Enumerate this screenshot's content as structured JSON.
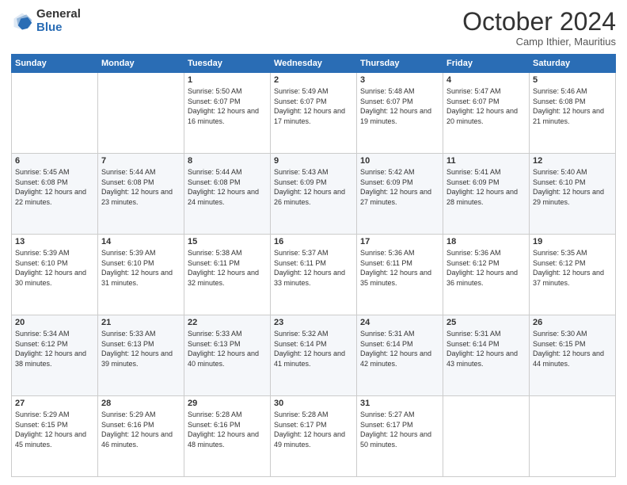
{
  "logo": {
    "general": "General",
    "blue": "Blue"
  },
  "header": {
    "month": "October 2024",
    "location": "Camp Ithier, Mauritius"
  },
  "weekdays": [
    "Sunday",
    "Monday",
    "Tuesday",
    "Wednesday",
    "Thursday",
    "Friday",
    "Saturday"
  ],
  "weeks": [
    [
      {
        "day": "",
        "info": ""
      },
      {
        "day": "",
        "info": ""
      },
      {
        "day": "1",
        "info": "Sunrise: 5:50 AM\nSunset: 6:07 PM\nDaylight: 12 hours and 16 minutes."
      },
      {
        "day": "2",
        "info": "Sunrise: 5:49 AM\nSunset: 6:07 PM\nDaylight: 12 hours and 17 minutes."
      },
      {
        "day": "3",
        "info": "Sunrise: 5:48 AM\nSunset: 6:07 PM\nDaylight: 12 hours and 19 minutes."
      },
      {
        "day": "4",
        "info": "Sunrise: 5:47 AM\nSunset: 6:07 PM\nDaylight: 12 hours and 20 minutes."
      },
      {
        "day": "5",
        "info": "Sunrise: 5:46 AM\nSunset: 6:08 PM\nDaylight: 12 hours and 21 minutes."
      }
    ],
    [
      {
        "day": "6",
        "info": "Sunrise: 5:45 AM\nSunset: 6:08 PM\nDaylight: 12 hours and 22 minutes."
      },
      {
        "day": "7",
        "info": "Sunrise: 5:44 AM\nSunset: 6:08 PM\nDaylight: 12 hours and 23 minutes."
      },
      {
        "day": "8",
        "info": "Sunrise: 5:44 AM\nSunset: 6:08 PM\nDaylight: 12 hours and 24 minutes."
      },
      {
        "day": "9",
        "info": "Sunrise: 5:43 AM\nSunset: 6:09 PM\nDaylight: 12 hours and 26 minutes."
      },
      {
        "day": "10",
        "info": "Sunrise: 5:42 AM\nSunset: 6:09 PM\nDaylight: 12 hours and 27 minutes."
      },
      {
        "day": "11",
        "info": "Sunrise: 5:41 AM\nSunset: 6:09 PM\nDaylight: 12 hours and 28 minutes."
      },
      {
        "day": "12",
        "info": "Sunrise: 5:40 AM\nSunset: 6:10 PM\nDaylight: 12 hours and 29 minutes."
      }
    ],
    [
      {
        "day": "13",
        "info": "Sunrise: 5:39 AM\nSunset: 6:10 PM\nDaylight: 12 hours and 30 minutes."
      },
      {
        "day": "14",
        "info": "Sunrise: 5:39 AM\nSunset: 6:10 PM\nDaylight: 12 hours and 31 minutes."
      },
      {
        "day": "15",
        "info": "Sunrise: 5:38 AM\nSunset: 6:11 PM\nDaylight: 12 hours and 32 minutes."
      },
      {
        "day": "16",
        "info": "Sunrise: 5:37 AM\nSunset: 6:11 PM\nDaylight: 12 hours and 33 minutes."
      },
      {
        "day": "17",
        "info": "Sunrise: 5:36 AM\nSunset: 6:11 PM\nDaylight: 12 hours and 35 minutes."
      },
      {
        "day": "18",
        "info": "Sunrise: 5:36 AM\nSunset: 6:12 PM\nDaylight: 12 hours and 36 minutes."
      },
      {
        "day": "19",
        "info": "Sunrise: 5:35 AM\nSunset: 6:12 PM\nDaylight: 12 hours and 37 minutes."
      }
    ],
    [
      {
        "day": "20",
        "info": "Sunrise: 5:34 AM\nSunset: 6:12 PM\nDaylight: 12 hours and 38 minutes."
      },
      {
        "day": "21",
        "info": "Sunrise: 5:33 AM\nSunset: 6:13 PM\nDaylight: 12 hours and 39 minutes."
      },
      {
        "day": "22",
        "info": "Sunrise: 5:33 AM\nSunset: 6:13 PM\nDaylight: 12 hours and 40 minutes."
      },
      {
        "day": "23",
        "info": "Sunrise: 5:32 AM\nSunset: 6:14 PM\nDaylight: 12 hours and 41 minutes."
      },
      {
        "day": "24",
        "info": "Sunrise: 5:31 AM\nSunset: 6:14 PM\nDaylight: 12 hours and 42 minutes."
      },
      {
        "day": "25",
        "info": "Sunrise: 5:31 AM\nSunset: 6:14 PM\nDaylight: 12 hours and 43 minutes."
      },
      {
        "day": "26",
        "info": "Sunrise: 5:30 AM\nSunset: 6:15 PM\nDaylight: 12 hours and 44 minutes."
      }
    ],
    [
      {
        "day": "27",
        "info": "Sunrise: 5:29 AM\nSunset: 6:15 PM\nDaylight: 12 hours and 45 minutes."
      },
      {
        "day": "28",
        "info": "Sunrise: 5:29 AM\nSunset: 6:16 PM\nDaylight: 12 hours and 46 minutes."
      },
      {
        "day": "29",
        "info": "Sunrise: 5:28 AM\nSunset: 6:16 PM\nDaylight: 12 hours and 48 minutes."
      },
      {
        "day": "30",
        "info": "Sunrise: 5:28 AM\nSunset: 6:17 PM\nDaylight: 12 hours and 49 minutes."
      },
      {
        "day": "31",
        "info": "Sunrise: 5:27 AM\nSunset: 6:17 PM\nDaylight: 12 hours and 50 minutes."
      },
      {
        "day": "",
        "info": ""
      },
      {
        "day": "",
        "info": ""
      }
    ]
  ]
}
